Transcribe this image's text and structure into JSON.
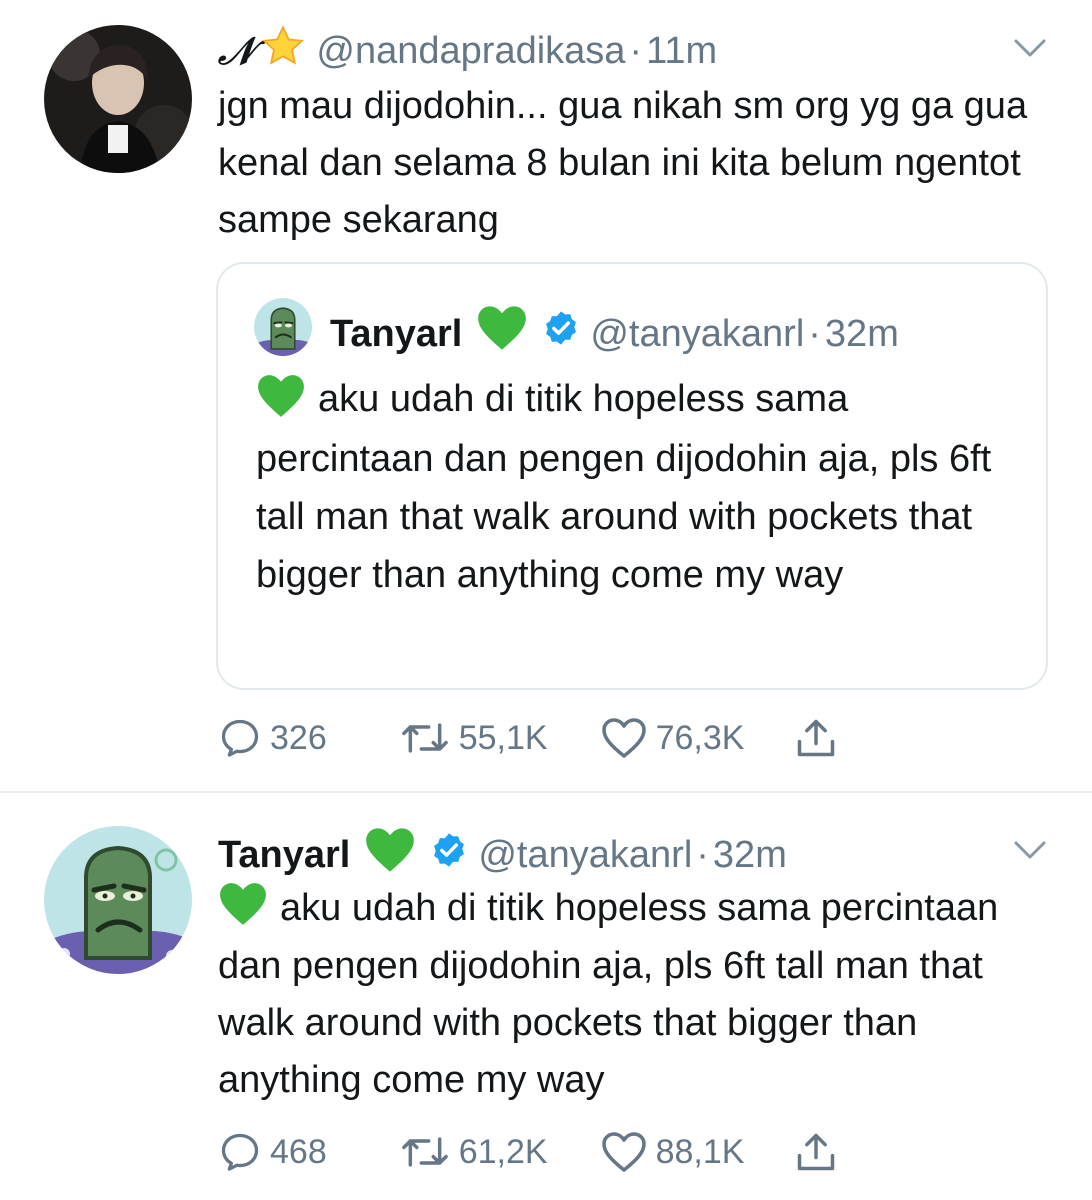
{
  "colors": {
    "text": "#14171a",
    "secondary": "#657786",
    "border": "#e1e8ed",
    "verified": "#1da1f2",
    "green_heart": "#3fb83f"
  },
  "tweet1": {
    "author": {
      "name": "𝒩",
      "handle": "@nandapradikasa",
      "time": "11m",
      "name_icon": "star-emoji"
    },
    "text": "jgn mau dijodohin... gua nikah sm org yg ga gua kenal dan selama 8 bulan ini kita belum ngentot sampe sekarang",
    "quote": {
      "author": {
        "name": "Tanyarl",
        "handle": "@tanyakanrl",
        "time": "32m",
        "name_icon": "green-heart-emoji",
        "verified": true
      },
      "text": "aku udah di titik hopeless sama percintaan dan pengen dijodohin aja, pls 6ft tall man that walk around with pockets that bigger than anything come my way"
    },
    "stats": {
      "replies": "326",
      "retweets": "55,1K",
      "likes": "76,3K"
    }
  },
  "tweet2": {
    "author": {
      "name": "Tanyarl",
      "handle": "@tanyakanrl",
      "time": "32m",
      "name_icon": "green-heart-emoji",
      "verified": true
    },
    "text": "aku udah di titik hopeless sama percintaan dan pengen dijodohin aja, pls 6ft tall man that walk around with pockets that bigger than anything come my way",
    "stats": {
      "replies": "468",
      "retweets": "61,2K",
      "likes": "88,1K"
    }
  },
  "separator": "·"
}
